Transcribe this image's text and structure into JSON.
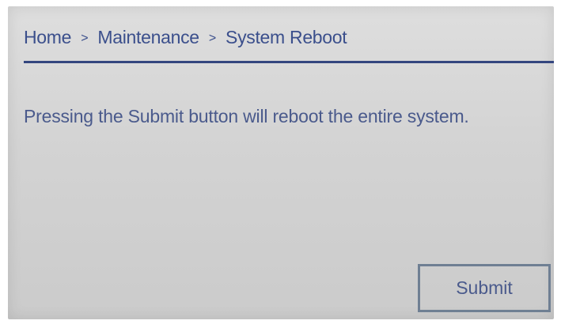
{
  "breadcrumb": {
    "items": [
      "Home",
      "Maintenance",
      "System Reboot"
    ],
    "separator": ">"
  },
  "message": "Pressing the Submit button will reboot the entire system.",
  "submit_label": "Submit",
  "colors": {
    "text": "#4a5a8c",
    "divider": "#34467f",
    "button_border": "#6f7f93",
    "background": "#d3d3d3"
  }
}
